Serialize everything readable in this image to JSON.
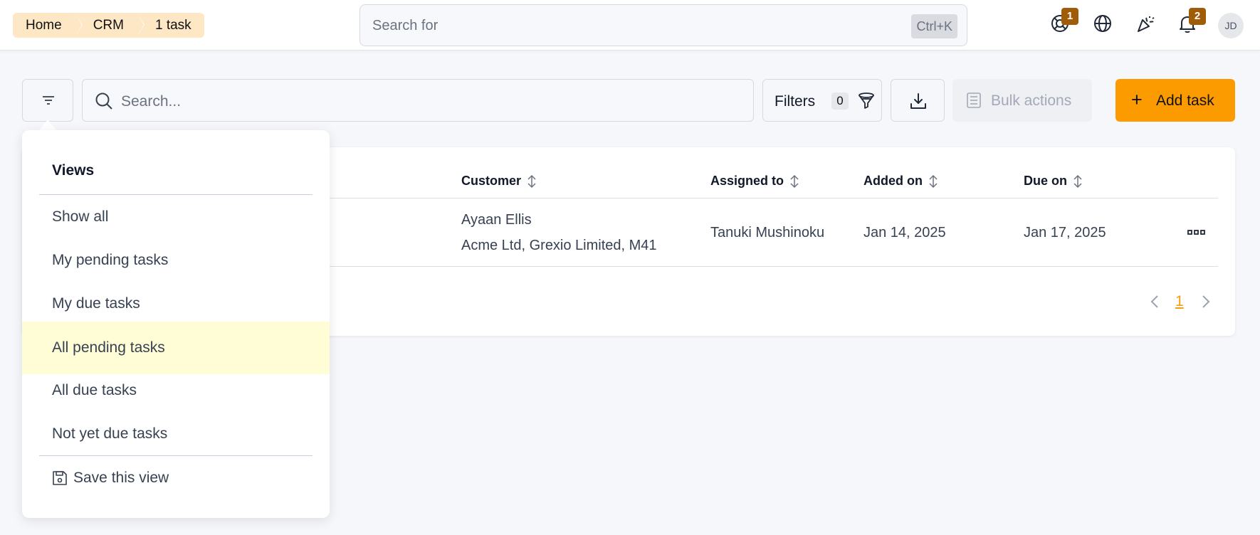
{
  "breadcrumb": [
    "Home",
    "CRM",
    "1 task"
  ],
  "global_search": {
    "placeholder": "Search for",
    "shortcut": "Ctrl+K"
  },
  "top_icons": {
    "support_badge": "1",
    "notifications_badge": "2",
    "avatar_initials": "JD"
  },
  "toolbar": {
    "search_placeholder": "Search...",
    "filters_label": "Filters",
    "filters_count": "0",
    "bulk_label": "Bulk actions",
    "add_label": "Add task"
  },
  "table": {
    "headers": {
      "customer": "Customer",
      "assigned": "Assigned to",
      "added": "Added on",
      "due": "Due on"
    },
    "rows": [
      {
        "customer_name": "Ayaan Ellis",
        "customer_company": "Acme Ltd, Grexio Limited, M41",
        "assigned_to": "Tanuki Mushinoku",
        "added_on": "Jan 14, 2025",
        "due_on": "Jan 17, 2025"
      }
    ],
    "page": "1"
  },
  "views_menu": {
    "title": "Views",
    "items": [
      "Show all",
      "My pending tasks",
      "My due tasks",
      "All pending tasks",
      "All due tasks",
      "Not yet due tasks"
    ],
    "active_item": "All pending tasks",
    "save_label": "Save this view"
  },
  "colors": {
    "accent": "#fb9b00",
    "breadcrumb_bg": "#fde7c4",
    "badge": "#a15c07",
    "active_row": "#fefdd6"
  }
}
